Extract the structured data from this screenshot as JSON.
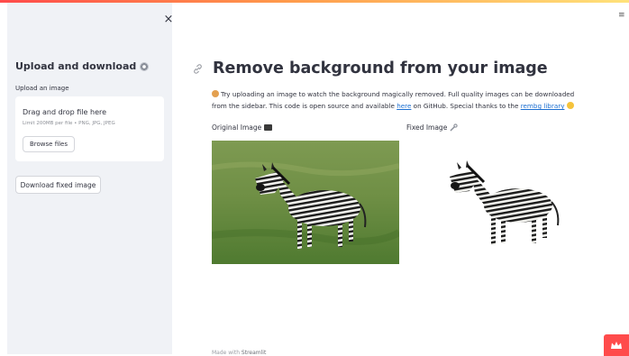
{
  "sidebar": {
    "close_glyph": "×",
    "title": "Upload and download",
    "title_icon": "gear-icon",
    "upload_label": "Upload an image",
    "dropzone_title": "Drag and drop file here",
    "dropzone_limit": "Limit 200MB per file • PNG, JPG, JPEG",
    "browse_label": "Browse files",
    "download_label": "Download fixed image"
  },
  "header": {
    "menu_glyph": "≡"
  },
  "main": {
    "title": "Remove background from your image",
    "intro_before_here": "Try uploading an image to watch the background magically removed. Full quality images can be downloaded from the sidebar. This code is open source and available ",
    "here_link": "here",
    "intro_middle": " on GitHub. Special thanks to the ",
    "rembg_link": "rembg library",
    "original_label": "Original Image",
    "fixed_label": "Fixed Image"
  },
  "footer": {
    "made_with": "Made with ",
    "brand": "Streamlit"
  },
  "colors": {
    "accent": "#ff4b4b",
    "link": "#1c6fd1",
    "sidebar_bg": "#f0f2f6",
    "text": "#31333f"
  }
}
